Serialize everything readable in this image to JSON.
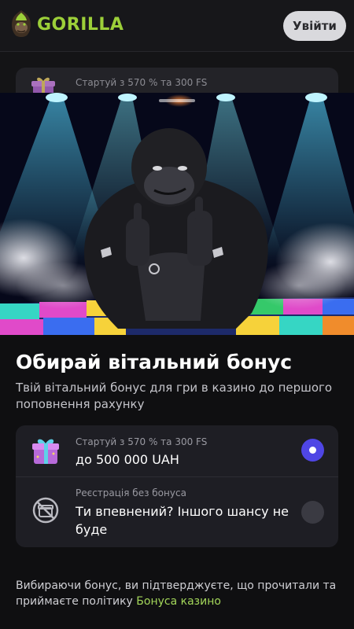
{
  "header": {
    "brand": "GORILLA",
    "login_label": "Увійти"
  },
  "background_card": {
    "label": "Стартуй з 570 % та 300 FS"
  },
  "sheet": {
    "title": "Обирай вітальний бонус",
    "subtitle": "Твій вітальний бонус для гри в казино до першого поповнення рахунку",
    "options": [
      {
        "small": "Стартуй з 570 % та 300 FS",
        "main": "до 500 000 UAH",
        "selected": true,
        "icon": "gift-icon"
      },
      {
        "small": "Реєстрація без бонуса",
        "main": "Ти впевнений? Іншого шансу не буде",
        "selected": false,
        "icon": "no-bonus-icon"
      }
    ],
    "footer_text": "Вибираючи бонус, ви підтверджуєте, що прочитали та приймаєте політику ",
    "footer_link": "Бонуса казино"
  },
  "colors": {
    "brand_green": "#9ccf39",
    "accent_blue": "#4f46e5",
    "link_green": "#a3d65a"
  }
}
